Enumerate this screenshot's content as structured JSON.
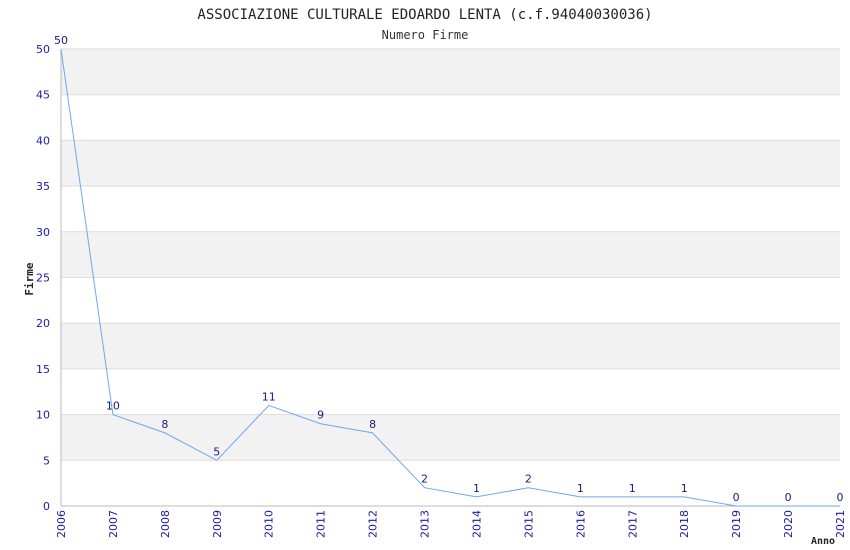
{
  "chart_data": {
    "type": "line",
    "title": "ASSOCIAZIONE CULTURALE EDOARDO LENTA (c.f.94040030036)",
    "subtitle": "Numero Firme",
    "ylabel": "Firme",
    "xlabel": "Anno",
    "x": [
      "2006",
      "2007",
      "2008",
      "2009",
      "2010",
      "2011",
      "2012",
      "2013",
      "2014",
      "2015",
      "2016",
      "2017",
      "2018",
      "2019",
      "2020",
      "2021"
    ],
    "values": [
      50,
      10,
      8,
      5,
      11,
      9,
      8,
      2,
      1,
      2,
      1,
      1,
      1,
      0,
      0,
      0
    ],
    "ylim": [
      0,
      50
    ],
    "yticks": [
      0,
      5,
      10,
      15,
      20,
      25,
      30,
      35,
      40,
      45,
      50
    ],
    "grid": true,
    "colors": {
      "line": "#6aa9ee",
      "band": "#f2f2f2",
      "tick_text": "#1a1aa6",
      "data_label": "#1a1a7a"
    }
  }
}
